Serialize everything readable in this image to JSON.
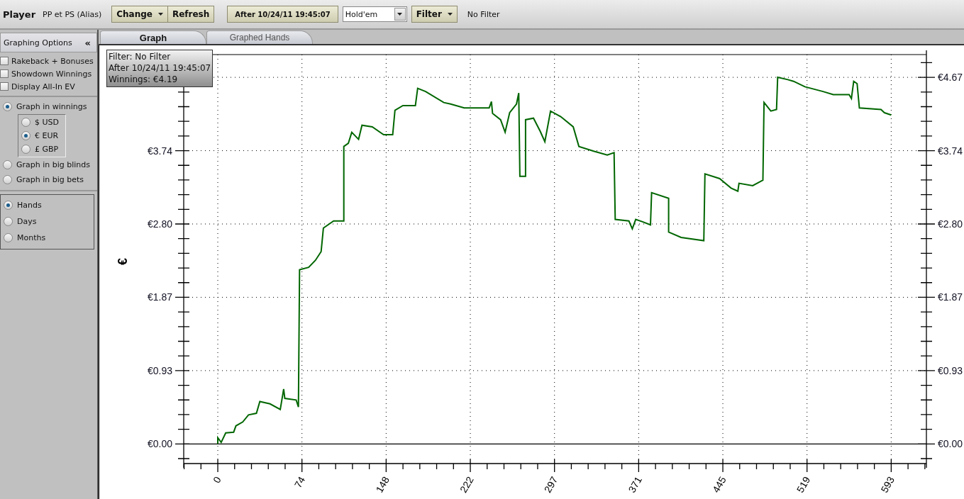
{
  "toolbar": {
    "label": "Player",
    "player": "PP et PS (Alias)",
    "buttons": [
      {
        "label": "Change",
        "dropdown": true
      },
      {
        "label": "Refresh",
        "dropdown": false
      }
    ],
    "date_button": "After 10/24/11 19:45:07",
    "game_select": {
      "value": "Hold'em"
    },
    "filter_button": {
      "label": "Filter",
      "dropdown": true
    },
    "filter_status": "No Filter"
  },
  "sidebar": {
    "title": "Graphing Options",
    "collapse_icon": "«",
    "checkboxes": [
      {
        "label": "Rakeback + Bonuses",
        "checked": false
      },
      {
        "label": "Showdown Winnings",
        "checked": false
      },
      {
        "label": "Display All-In EV",
        "checked": false
      }
    ],
    "units": [
      {
        "label": "Graph in winnings",
        "selected": true,
        "currencies": [
          {
            "label": "$ USD",
            "selected": false
          },
          {
            "label": "€ EUR",
            "selected": true
          },
          {
            "label": "£ GBP",
            "selected": false
          }
        ]
      },
      {
        "label": "Graph in big blinds",
        "selected": false
      },
      {
        "label": "Graph in big bets",
        "selected": false
      }
    ],
    "timeframes": [
      {
        "label": "Hands",
        "selected": true
      },
      {
        "label": "Days",
        "selected": false
      },
      {
        "label": "Months",
        "selected": false
      }
    ]
  },
  "tabs": [
    {
      "label": "Graph",
      "selected": true
    },
    {
      "label": "Graphed Hands",
      "selected": false
    }
  ],
  "graph": {
    "info_box": [
      "Filter: No Filter",
      "After 10/24/11 19:45:07",
      "Winnings: €4.19"
    ],
    "chart_data": {
      "type": "line",
      "grid": true,
      "ylabel": "€",
      "xlim": [
        -30,
        624
      ],
      "ylim": [
        -0.25,
        4.96
      ],
      "xticks": [
        {
          "value": 0,
          "label": "0"
        },
        {
          "value": 74.125,
          "label": "74"
        },
        {
          "value": 148.25,
          "label": "148"
        },
        {
          "value": 222.375,
          "label": "222"
        },
        {
          "value": 296.5,
          "label": "297"
        },
        {
          "value": 370.625,
          "label": "371"
        },
        {
          "value": 444.75,
          "label": "445"
        },
        {
          "value": 518.875,
          "label": "519"
        },
        {
          "value": 593,
          "label": "593"
        }
      ],
      "yticks": [
        {
          "value": 0,
          "label": "€0.00"
        },
        {
          "value": 0.934,
          "label": "€0.93"
        },
        {
          "value": 1.868,
          "label": "€1.87"
        },
        {
          "value": 2.802,
          "label": "€2.80"
        },
        {
          "value": 3.736,
          "label": "€3.74"
        },
        {
          "value": 4.67,
          "label": "€4.67"
        }
      ],
      "x": [
        0,
        0,
        3,
        7,
        14,
        16,
        22,
        27,
        34,
        37,
        46,
        55,
        58,
        59,
        69,
        71,
        72,
        80,
        86,
        91,
        93,
        102,
        111,
        111,
        115,
        118,
        124,
        127,
        136,
        146,
        154,
        156,
        163,
        174,
        176,
        183,
        199,
        205,
        217,
        239,
        241,
        242,
        249,
        253,
        257,
        263,
        265,
        266,
        271,
        271,
        278,
        284,
        288,
        293,
        302,
        313,
        318,
        331,
        343,
        349,
        350,
        362,
        365,
        368,
        374,
        381,
        382,
        397,
        397,
        408,
        428,
        429,
        442,
        452,
        458,
        459,
        471,
        480,
        481,
        487,
        492,
        493,
        502,
        507,
        517,
        533,
        542,
        556,
        558,
        560,
        563,
        565,
        584,
        587,
        593
      ],
      "series": [
        {
          "color": "#006600",
          "values": [
            0,
            0.08,
            0.02,
            0.14,
            0.15,
            0.23,
            0.28,
            0.37,
            0.39,
            0.54,
            0.51,
            0.44,
            0.7,
            0.58,
            0.56,
            0.47,
            2.22,
            2.25,
            2.34,
            2.45,
            2.75,
            2.84,
            2.84,
            3.79,
            3.83,
            3.97,
            3.88,
            4.06,
            4.04,
            3.94,
            3.94,
            4.25,
            4.31,
            4.31,
            4.53,
            4.49,
            4.35,
            4.33,
            4.28,
            4.28,
            4.36,
            4.21,
            4.13,
            3.97,
            4.22,
            4.33,
            4.47,
            3.41,
            3.41,
            4.13,
            4.15,
            3.98,
            3.85,
            4.24,
            4.17,
            4.04,
            3.79,
            3.73,
            3.68,
            3.71,
            2.86,
            2.84,
            2.74,
            2.86,
            2.83,
            2.79,
            3.2,
            3.13,
            2.7,
            2.63,
            2.59,
            3.44,
            3.38,
            3.26,
            3.22,
            3.32,
            3.29,
            3.36,
            4.35,
            4.24,
            4.26,
            4.67,
            4.64,
            4.62,
            4.55,
            4.49,
            4.45,
            4.45,
            4.4,
            4.62,
            4.59,
            4.28,
            4.26,
            4.22,
            4.19
          ]
        }
      ]
    }
  }
}
